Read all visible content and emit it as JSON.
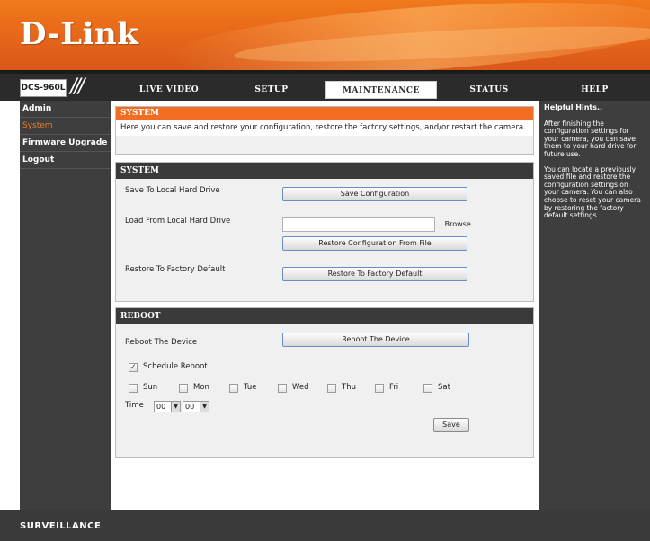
{
  "brand": {
    "logo": "D-Link",
    "model": "DCS-960L",
    "slashes": "///",
    "footer": "SURVEILLANCE"
  },
  "nav": {
    "tabs": [
      {
        "label": "LIVE VIDEO"
      },
      {
        "label": "SETUP"
      },
      {
        "label": "MAINTENANCE"
      },
      {
        "label": "STATUS"
      },
      {
        "label": "HELP"
      }
    ],
    "active": "MAINTENANCE"
  },
  "sidebar": {
    "items": [
      {
        "label": "Admin"
      },
      {
        "label": "System"
      },
      {
        "label": "Firmware Upgrade"
      },
      {
        "label": "Logout"
      }
    ],
    "active": "System"
  },
  "system_intro": {
    "title": "SYSTEM",
    "text": "Here you can save and restore your configuration, restore the factory settings, and/or restart the camera."
  },
  "system_panel": {
    "title": "SYSTEM",
    "save_local_label": "Save To Local Hard Drive",
    "save_button": "Save Configuration",
    "load_local_label": "Load From Local Hard Drive",
    "file_input_value": "",
    "browse_button": "Browse...",
    "restore_file_button": "Restore Configuration From File",
    "factory_label": "Restore To Factory Default",
    "factory_button": "Restore To Factory Default"
  },
  "reboot_panel": {
    "title": "REBOOT",
    "reboot_label": "Reboot The Device",
    "reboot_button": "Reboot The Device",
    "schedule_label": "Schedule Reboot",
    "schedule_checked": "✓",
    "days": [
      "Sun",
      "Mon",
      "Tue",
      "Wed",
      "Thu",
      "Fri",
      "Sat"
    ],
    "time_label": "Time",
    "hour_value": "00",
    "minute_value": "00",
    "save_button": "Save"
  },
  "hints": {
    "title": "Helpful Hints..",
    "p1": "After finishing the configuration settings for your camera, you can save them to your hard drive for future use.",
    "p2": "You can locate a previously saved file and restore the configuration settings on your camera. You can also choose to reset your camera by restoring the factory default settings."
  },
  "colors": {
    "accent": "#f26c21",
    "dark": "#3e3e3e",
    "nav": "#2b2b2b"
  }
}
